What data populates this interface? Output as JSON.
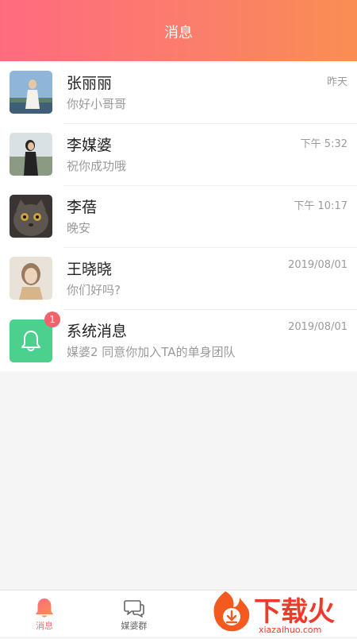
{
  "header": {
    "title": "消息"
  },
  "messages": [
    {
      "name": "张丽丽",
      "preview": "你好小哥哥",
      "time": "昨天"
    },
    {
      "name": "李媒婆",
      "preview": "祝你成功哦",
      "time": "下午 5:32"
    },
    {
      "name": "李蓓",
      "preview": "晚安",
      "time": "下午 10:17"
    },
    {
      "name": "王晓晓",
      "preview": "你们好吗?",
      "time": "2019/08/01"
    },
    {
      "name": "系统消息",
      "preview": "媒婆2 同意你加入TA的单身团队",
      "time": "2019/08/01",
      "badge": "1"
    }
  ],
  "tabbar": {
    "tabs": [
      {
        "label": "消息",
        "icon": "bell-icon",
        "active": true
      },
      {
        "label": "媒婆群",
        "icon": "chat-bubbles-icon",
        "active": false
      }
    ]
  },
  "watermark": {
    "text": "下载火",
    "domain": "xiazaihuo.com"
  },
  "colors": {
    "header_start": "#fe6b7f",
    "header_end": "#f98e52",
    "system_icon_bg": "#4cd08d",
    "badge": "#f4616b"
  }
}
